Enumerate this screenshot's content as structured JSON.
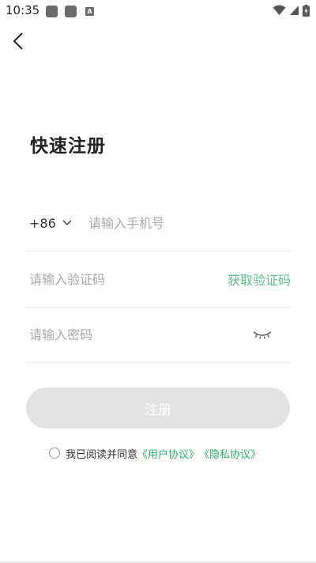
{
  "status_bar": {
    "time": "10:35",
    "notification_badge": "A"
  },
  "header": {
    "title": "快速注册"
  },
  "form": {
    "country_code": "+86",
    "phone_placeholder": "请输入手机号",
    "code_placeholder": "请输入验证码",
    "get_code_label": "获取验证码",
    "password_placeholder": "请输入密码"
  },
  "register_button": {
    "label": "注册"
  },
  "agreement": {
    "prefix": "我已阅读并同意",
    "user_agreement": "《用户协议》",
    "privacy_agreement": "《隐私协议》"
  },
  "colors": {
    "accent_green": "#2fb36a",
    "link_green_light": "#5bbf8a",
    "button_disabled": "#e3e3e3"
  }
}
